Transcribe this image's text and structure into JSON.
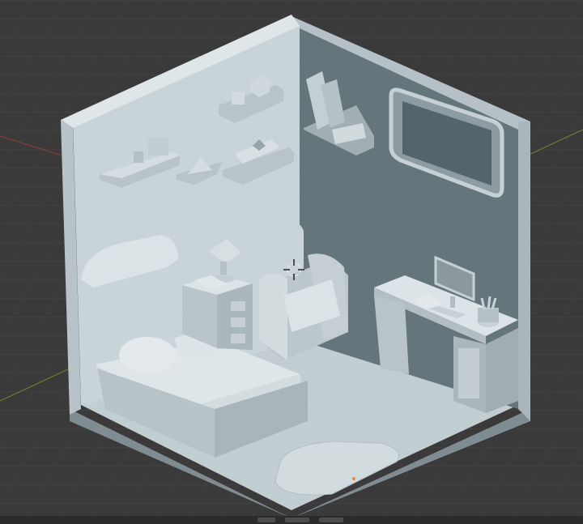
{
  "viewport": {
    "background": "#3a3a3a",
    "grid_color": "#464646",
    "x_axis_color": "#9a3b3b",
    "y_axis_color": "#6f8a2a"
  },
  "materials": {
    "clay_light": "#c9d4d8",
    "clay_mid": "#a9b6bb",
    "clay_dark": "#7f8d93",
    "back_wall": "#64757b",
    "outline": "#3f4a4f"
  },
  "objects": [
    "room-floor",
    "left-wall",
    "right-wall",
    "window-opening",
    "bed",
    "pillow-heart",
    "pillow-star",
    "nightstand",
    "table-lamp",
    "armchair",
    "desk",
    "monitor",
    "keyboard",
    "open-book",
    "pen-cup",
    "wall-shelf",
    "rug",
    "3d-cursor-icon",
    "world-origin-icon"
  ]
}
